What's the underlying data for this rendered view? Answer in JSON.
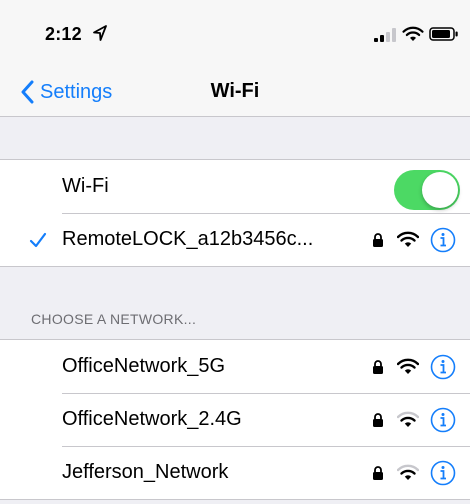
{
  "status_bar": {
    "time": "2:12"
  },
  "nav": {
    "back_label": "Settings",
    "title": "Wi-Fi"
  },
  "wifi_toggle": {
    "label": "Wi-Fi",
    "on": true
  },
  "connected_network": {
    "name": "RemoteLOCK_a12b3456c...",
    "secured": true,
    "signal": "full"
  },
  "choose_header": "CHOOSE A NETWORK...",
  "networks": [
    {
      "name": "OfficeNetwork_5G",
      "secured": true,
      "signal": "full"
    },
    {
      "name": "OfficeNetwork_2.4G",
      "secured": true,
      "signal": "partial"
    },
    {
      "name": "Jefferson_Network",
      "secured": true,
      "signal": "partial"
    }
  ],
  "colors": {
    "accent": "#147efb",
    "toggle_on": "#4cd964",
    "background": "#efeff4",
    "separator": "#c8c7cc",
    "header_text": "#6d6d72"
  }
}
